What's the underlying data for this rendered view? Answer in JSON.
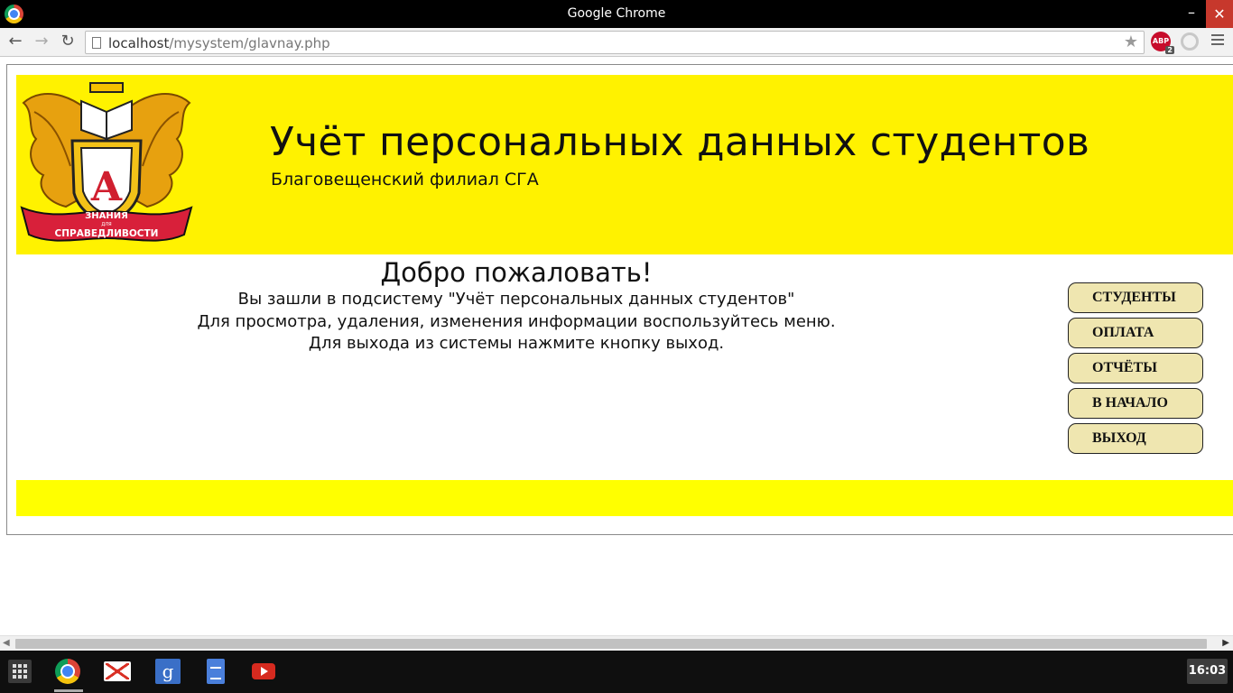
{
  "window": {
    "title": "Google Chrome"
  },
  "toolbar": {
    "url_host": "localhost",
    "url_path": "/mysystem/glavnay.php",
    "abp_label": "ABP",
    "abp_badge": "2"
  },
  "header": {
    "title": "Учёт персональных данных студентов",
    "subtitle": "Благовещенский филиал СГА",
    "logo_ribbon_top": "ЗНАНИЯ",
    "logo_ribbon_small": "ДЛЯ",
    "logo_ribbon_bottom": "СПРАВЕДЛИВОСТИ",
    "logo_letter": "А"
  },
  "welcome": {
    "heading": "Добро пожаловать!",
    "line1": "Вы зашли в подсистему \"Учёт персональных данных студентов\"",
    "line2": "Для просмотра, удаления, изменения информации воспользуйтесь меню.",
    "line3": "Для выхода из системы нажмите кнопку выход."
  },
  "menu": {
    "items": [
      {
        "label": "СТУДЕНТЫ"
      },
      {
        "label": "ОПЛАТА"
      },
      {
        "label": "ОТЧЁТЫ"
      },
      {
        "label": "В НАЧАЛО"
      },
      {
        "label": "ВЫХОД"
      }
    ]
  },
  "taskbar": {
    "clock": "16:03",
    "gplus_label": "g"
  },
  "colors": {
    "header_bg": "#fff200",
    "footer_bg": "#ffff00",
    "menu_button_bg": "#efe6b0"
  }
}
